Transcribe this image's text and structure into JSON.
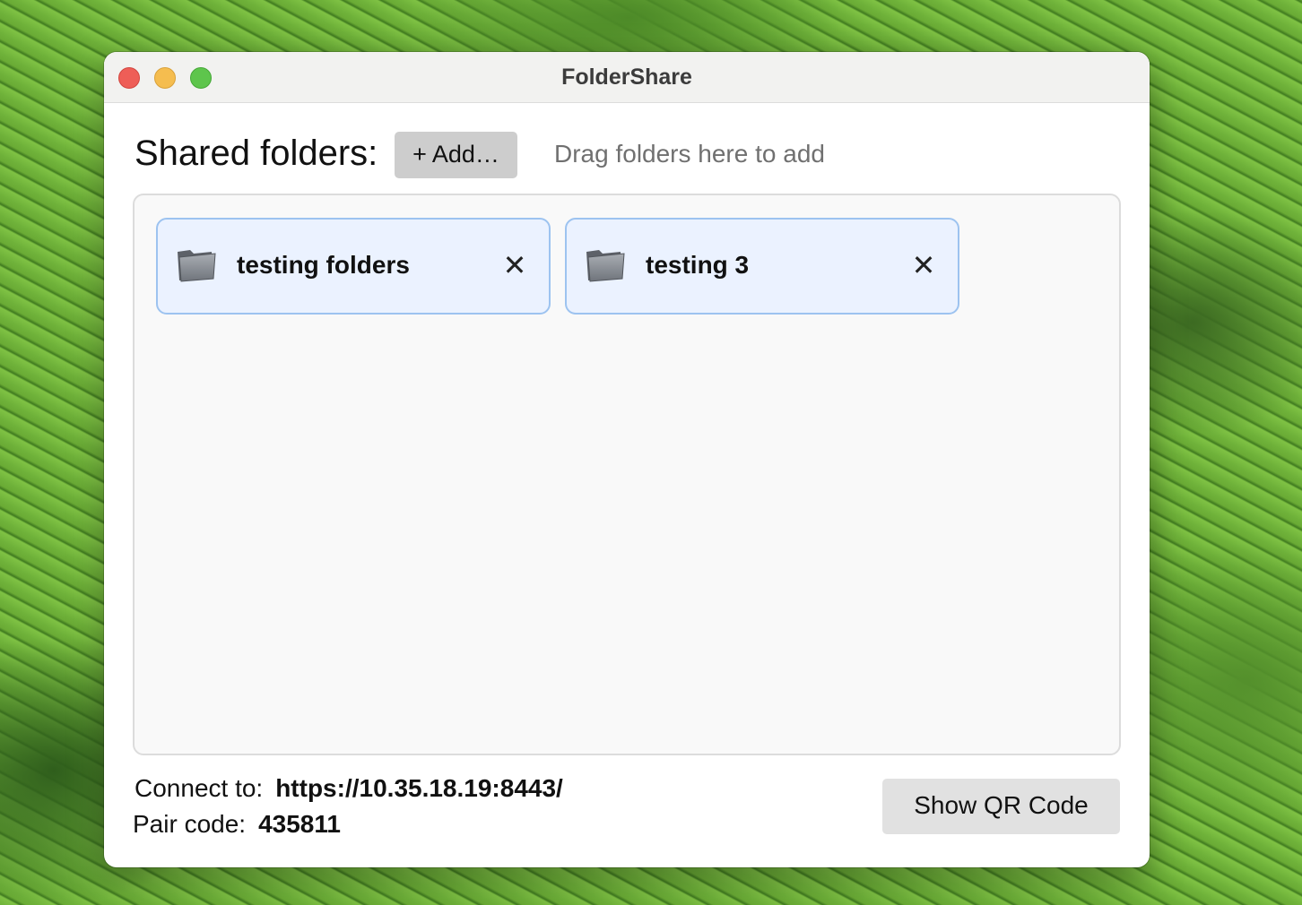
{
  "window": {
    "title": "FolderShare"
  },
  "header": {
    "label": "Shared folders:",
    "add_button_label": "+ Add…",
    "hint": "Drag folders here to add"
  },
  "folders": [
    {
      "name": "testing folders",
      "icon": "folder-icon",
      "remove_label": "✕"
    },
    {
      "name": "testing 3",
      "icon": "folder-icon",
      "remove_label": "✕"
    }
  ],
  "footer": {
    "connect_label": "Connect to:",
    "connect_url": "https://10.35.18.19:8443/",
    "pair_label": "Pair code:",
    "pair_code": "435811",
    "qr_button_label": "Show QR Code"
  },
  "colors": {
    "chip_background": "#ebf2ff",
    "chip_border": "#9dc3f0",
    "traffic_close": "#ee5e57",
    "traffic_minimize": "#f5bd4f",
    "traffic_zoom": "#5ec54c"
  }
}
